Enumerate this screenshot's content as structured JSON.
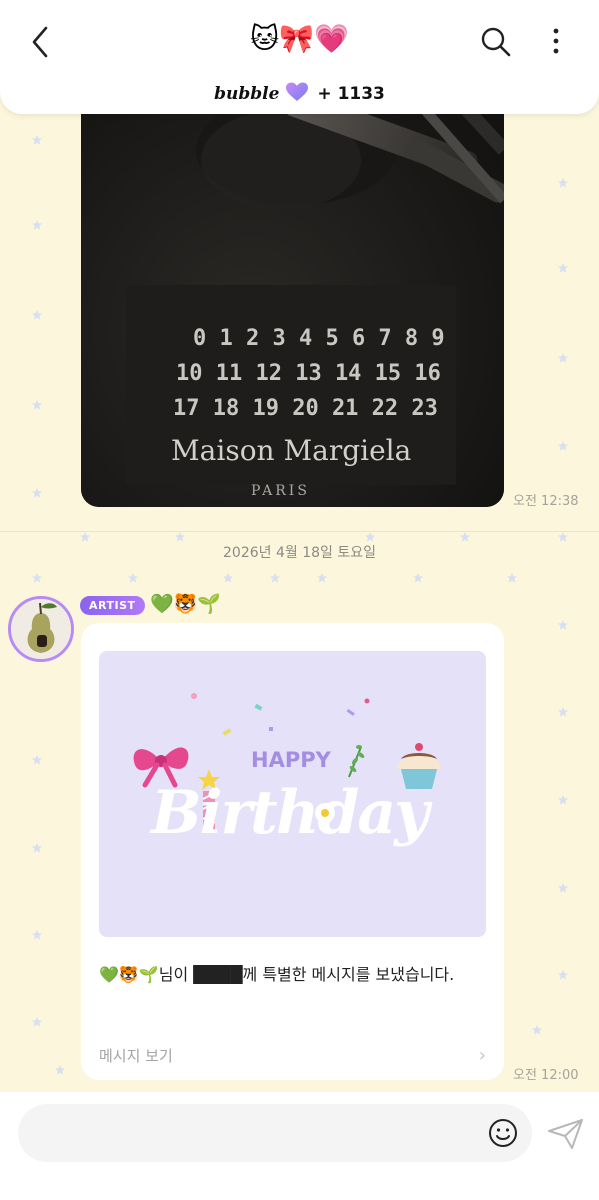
{
  "header": {
    "title_emojis": "🐱🎀💗",
    "brand": "bubble",
    "member_count": "+ 1133"
  },
  "chat": {
    "photo_time": "오전 12:38",
    "date_divider": "2026년 4월 18일 토요일",
    "artist_badge": "ARTIST",
    "artist_name": "💚🐯🌱",
    "card": {
      "happy": "HAPPY",
      "birthday": "Birthday",
      "message": "💚🐯🌱님이 ████께 특별한 메시지를 보냈습니다.",
      "footer": "메시지 보기"
    },
    "card_time": "오전 12:00"
  },
  "photo_content": {
    "row1": "0 1 2 3 4 5 6 7 8 9",
    "row2": "10 11 12 13 14 15 16",
    "row3": "17 18 19 20 21 22 23",
    "brand": "Maison Margiela",
    "city": "PARIS"
  },
  "input": {
    "placeholder": ""
  },
  "colors": {
    "background": "#fbf6dc",
    "accent": "#8a63f0",
    "card_bg": "#e4e1f9"
  }
}
